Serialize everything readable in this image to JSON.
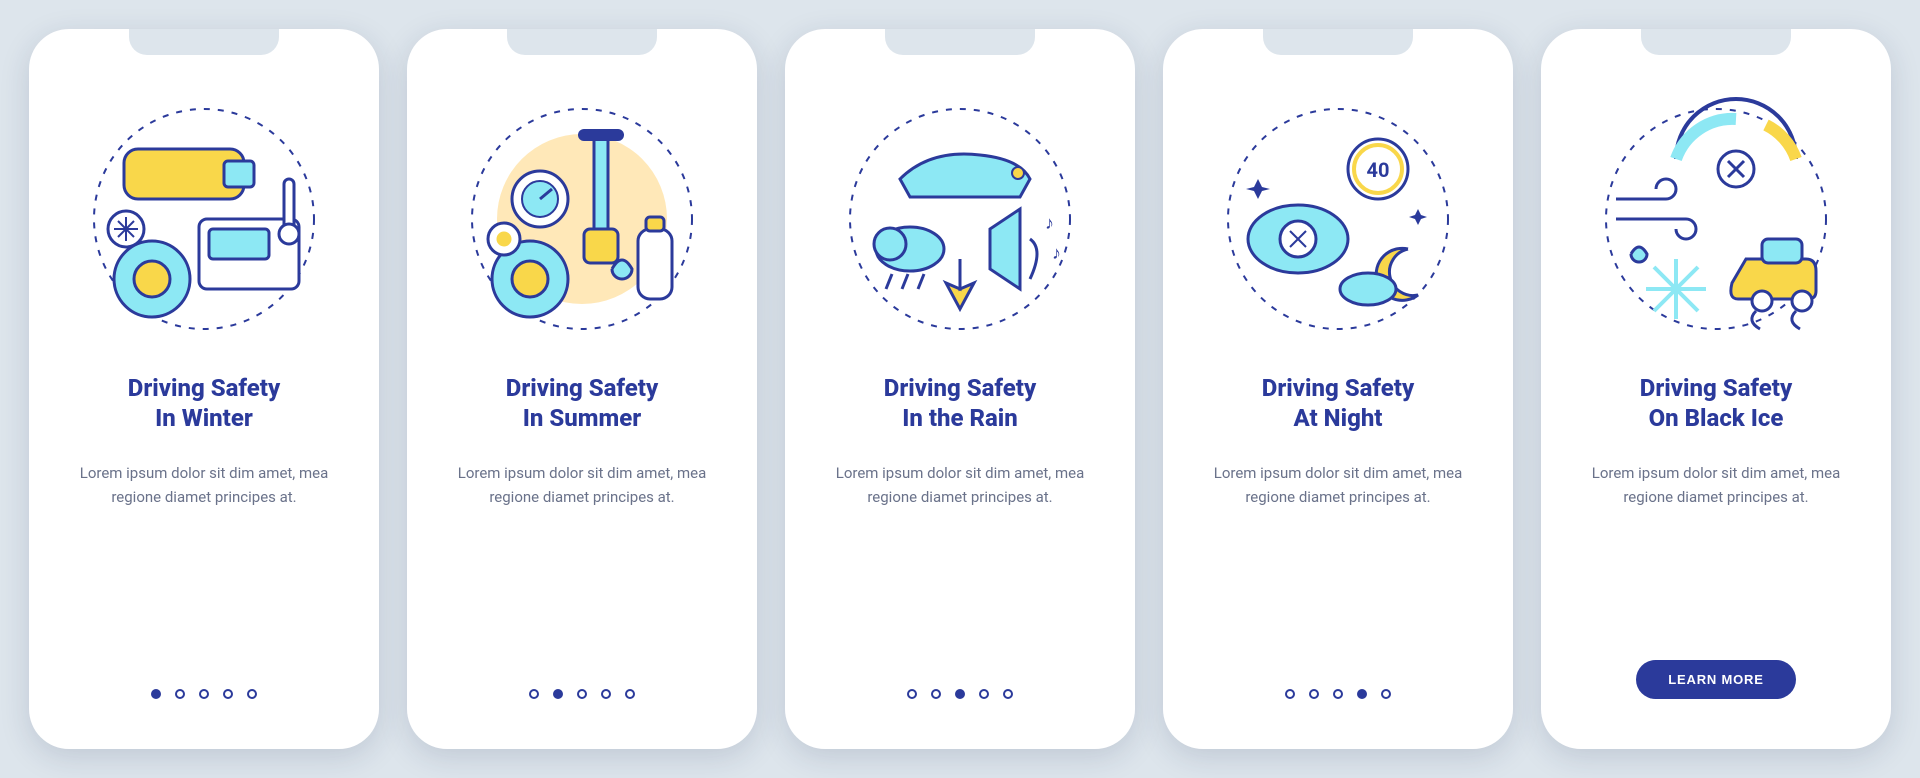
{
  "colors": {
    "brand": "#2b3a9b",
    "accentCyan": "#8de8f4",
    "accentYellow": "#f9d74a",
    "bodyText": "#6a728a",
    "pageBg": "#dde5ec",
    "cardBg": "#ffffff"
  },
  "screens": [
    {
      "illustration": "winter-driving-icon",
      "title": "Driving Safety\nIn Winter",
      "body": "Lorem ipsum dolor sit dim amet, mea regione diamet principes at.",
      "pageIndex": 0,
      "hasCta": false
    },
    {
      "illustration": "summer-driving-icon",
      "title": "Driving Safety\nIn Summer",
      "body": "Lorem ipsum dolor sit dim amet, mea regione diamet principes at.",
      "pageIndex": 1,
      "hasCta": false
    },
    {
      "illustration": "rain-driving-icon",
      "title": "Driving Safety\nIn the Rain",
      "body": "Lorem ipsum dolor sit dim amet, mea regione diamet principes at.",
      "pageIndex": 2,
      "hasCta": false
    },
    {
      "illustration": "night-driving-icon",
      "title": "Driving Safety\nAt Night",
      "body": "Lorem ipsum dolor sit dim amet, mea regione diamet principes at.",
      "pageIndex": 3,
      "hasCta": false
    },
    {
      "illustration": "black-ice-driving-icon",
      "title": "Driving Safety\nOn Black Ice",
      "body": "Lorem ipsum dolor sit dim amet, mea regione diamet principes at.",
      "pageIndex": 4,
      "hasCta": true
    }
  ],
  "totalPages": 5,
  "ctaLabel": "LEARN MORE"
}
